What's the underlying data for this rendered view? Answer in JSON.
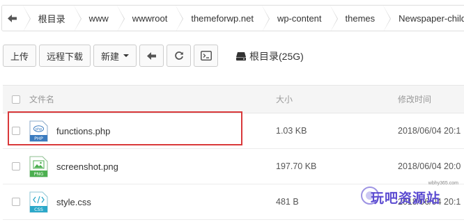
{
  "breadcrumb": {
    "back_icon": "arrow-left-icon",
    "items": [
      "根目录",
      "www",
      "wwwroot",
      "themeforwp.net",
      "wp-content",
      "themes",
      "Newspaper-child"
    ]
  },
  "toolbar": {
    "upload_label": "上传",
    "remote_download_label": "远程下载",
    "new_label": "新建",
    "back_icon": "arrow-left-icon",
    "refresh_icon": "refresh-icon",
    "terminal_icon": "terminal-icon"
  },
  "disk": {
    "label": "根目录(25G)",
    "icon": "hard-drive-icon"
  },
  "table": {
    "headers": {
      "name": "文件名",
      "size": "大小",
      "modified": "修改时间"
    },
    "rows": [
      {
        "name": "functions.php",
        "type": "PHP",
        "size": "1.03 KB",
        "modified": "2018/06/04 20:1"
      },
      {
        "name": "screenshot.png",
        "type": "PNG",
        "size": "197.70 KB",
        "modified": "2018/06/04 20:0"
      },
      {
        "name": "style.css",
        "type": "CSS",
        "size": "481 B",
        "modified": "2018/06/04 20:1"
      }
    ]
  },
  "watermark": {
    "url": "wbhy365.com",
    "text": "玩吧资源站"
  },
  "colors": {
    "highlight": "#d9383a",
    "php": "#3a7bbf",
    "png": "#4caf50",
    "css": "#2aa8c9",
    "watermark": "#5b4bd1"
  }
}
